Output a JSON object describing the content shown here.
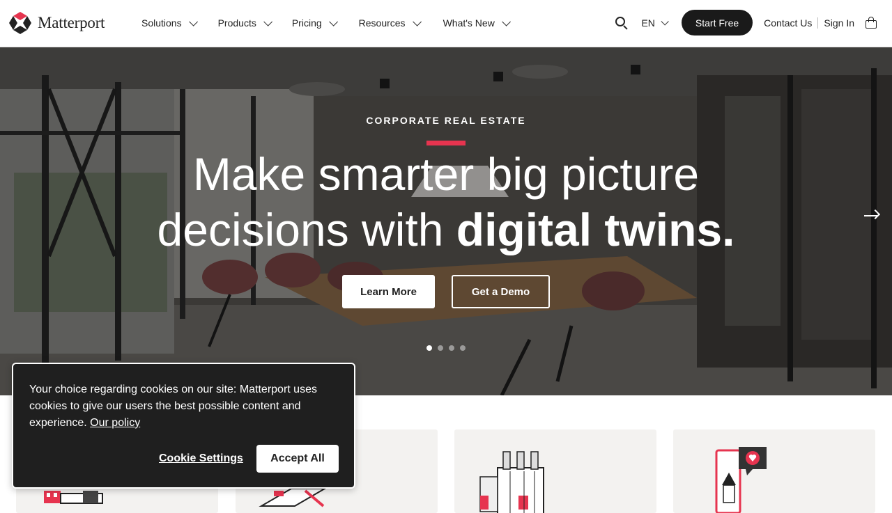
{
  "brand": {
    "name": "Matterport",
    "accent": "#e6344f"
  },
  "nav": {
    "menu": [
      {
        "label": "Solutions"
      },
      {
        "label": "Products"
      },
      {
        "label": "Pricing"
      },
      {
        "label": "Resources"
      },
      {
        "label": "What's New"
      }
    ],
    "language": "EN",
    "start_free": "Start Free",
    "contact": "Contact Us",
    "sign_in": "Sign In"
  },
  "hero": {
    "eyebrow": "CORPORATE REAL ESTATE",
    "headline_line1": "Make smarter big picture",
    "headline_line2_regular": "decisions with ",
    "headline_line2_bold": "digital twins.",
    "learn_more": "Learn More",
    "get_demo": "Get a Demo",
    "slide_count": 4,
    "active_slide": 1
  },
  "cookie": {
    "message": "Your choice regarding cookies on our site: Matterport uses cookies to give our users the best possible content and experience.",
    "policy_link": "Our policy",
    "settings": "Cookie Settings",
    "accept": "Accept All"
  }
}
